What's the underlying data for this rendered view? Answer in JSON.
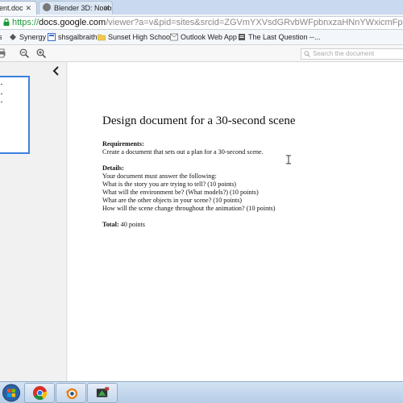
{
  "tabs": [
    {
      "label": "ent.doc",
      "active": true
    },
    {
      "label": "Blender 3D: Noob to Pro/",
      "active": false
    }
  ],
  "address": {
    "scheme": "https://",
    "host": "docs.google.com",
    "path": "/viewer?a=v&pid=sites&srcid=ZGVmYXVsdGRvbWFpbnxzaHNnYWxicmFpdGh8Z3g6MW"
  },
  "bookmarks": [
    {
      "label": "s",
      "icon": "generic"
    },
    {
      "label": "Synergy",
      "icon": "synergy-icon"
    },
    {
      "label": "shsgalbraith",
      "icon": "sites-icon"
    },
    {
      "label": "Sunset High School",
      "icon": "folder-icon"
    },
    {
      "label": "Outlook Web App",
      "icon": "outlook-icon"
    },
    {
      "label": "The Last Question --...",
      "icon": "page-icon"
    }
  ],
  "toolbar": {
    "search_placeholder": "Search the document"
  },
  "document": {
    "title": "Design document for a 30-second scene",
    "requirements_heading": "Requirements:",
    "requirements_text": "Create a document that sets out a plan for a 30-second scene.",
    "details_heading": "Details:",
    "details_lines": [
      "Your document must answer the following:",
      "What is the story you are trying to tell? (10 points)",
      "What will the environment be?  (What models?) (10 points)",
      "What are the other objects in your scene? (10 points)",
      "How will the scene change throughout the animation? (10 points)"
    ],
    "total_heading": "Total:",
    "total_text": "40 points"
  },
  "colors": {
    "accent": "#3d7fe0",
    "https_green": "#1a9b3a"
  }
}
